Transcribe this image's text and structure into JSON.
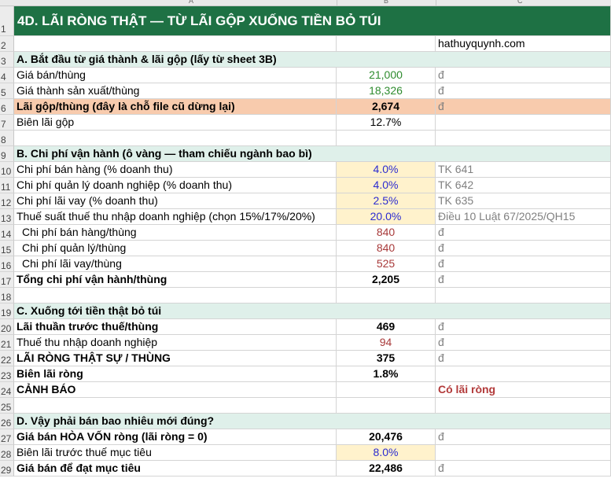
{
  "columns": [
    "A",
    "B",
    "C"
  ],
  "title": "4D. LÃI RÒNG THẬT — TỪ LÃI GỘP XUỐNG TIỀN BỎ TÚI",
  "site": "hathuyquynh.com",
  "sections": {
    "a": "A. Bắt đầu từ giá thành & lãi gộp (lấy từ sheet 3B)",
    "b": "B. Chi phí vận hành (ô vàng — tham chiếu ngành bao bì)",
    "c": "C. Xuống tới tiền thật bỏ túi",
    "d": "D. Vậy phải bán bao nhiêu mới đúng?"
  },
  "rows": {
    "r4": {
      "label": "Giá bán/thùng",
      "value": "21,000",
      "unit": "đ"
    },
    "r5": {
      "label": "Giá thành sản xuất/thùng",
      "value": "18,326",
      "unit": "đ"
    },
    "r6": {
      "label": "Lãi gộp/thùng (đây là chỗ file cũ dừng lại)",
      "value": "2,674",
      "unit": "đ"
    },
    "r7": {
      "label": "Biên lãi gộp",
      "value": "12.7%"
    },
    "r10": {
      "label": "Chi phí bán hàng (% doanh thu)",
      "value": "4.0%",
      "note": "TK 641"
    },
    "r11": {
      "label": "Chi phí quản lý doanh nghiệp (% doanh thu)",
      "value": "4.0%",
      "note": "TK 642"
    },
    "r12": {
      "label": "Chi phí lãi vay (% doanh thu)",
      "value": "2.5%",
      "note": "TK 635"
    },
    "r13": {
      "label": "Thuế suất thuế thu nhập doanh nghiệp (chọn 15%/17%/20%)",
      "value": "20.0%",
      "note": "Điều 10 Luật 67/2025/QH15"
    },
    "r14": {
      "label": "Chi phí bán hàng/thùng",
      "value": "840",
      "unit": "đ"
    },
    "r15": {
      "label": "Chi phí quản lý/thùng",
      "value": "840",
      "unit": "đ"
    },
    "r16": {
      "label": "Chi phí lãi vay/thùng",
      "value": "525",
      "unit": "đ"
    },
    "r17": {
      "label": "Tổng chi phí vận hành/thùng",
      "value": "2,205",
      "unit": "đ"
    },
    "r20": {
      "label": "Lãi thuần trước thuế/thùng",
      "value": "469",
      "unit": "đ"
    },
    "r21": {
      "label": "Thuế thu nhập doanh nghiệp",
      "value": "94",
      "unit": "đ"
    },
    "r22": {
      "label": "LÃI RÒNG THẬT SỰ / THÙNG",
      "value": "375",
      "unit": "đ"
    },
    "r23": {
      "label": "Biên lãi ròng",
      "value": "1.8%"
    },
    "r24": {
      "label": "CẢNH BÁO",
      "value": "",
      "note": "Có lãi ròng"
    },
    "r27": {
      "label": "Giá bán HÒA VỐN ròng (lãi ròng = 0)",
      "value": "20,476",
      "unit": "đ"
    },
    "r28": {
      "label": "Biên lãi trước thuế mục tiêu",
      "value": "8.0%"
    },
    "r29": {
      "label": "Giá bán để đạt mục tiêu",
      "value": "22,486",
      "unit": "đ"
    }
  }
}
